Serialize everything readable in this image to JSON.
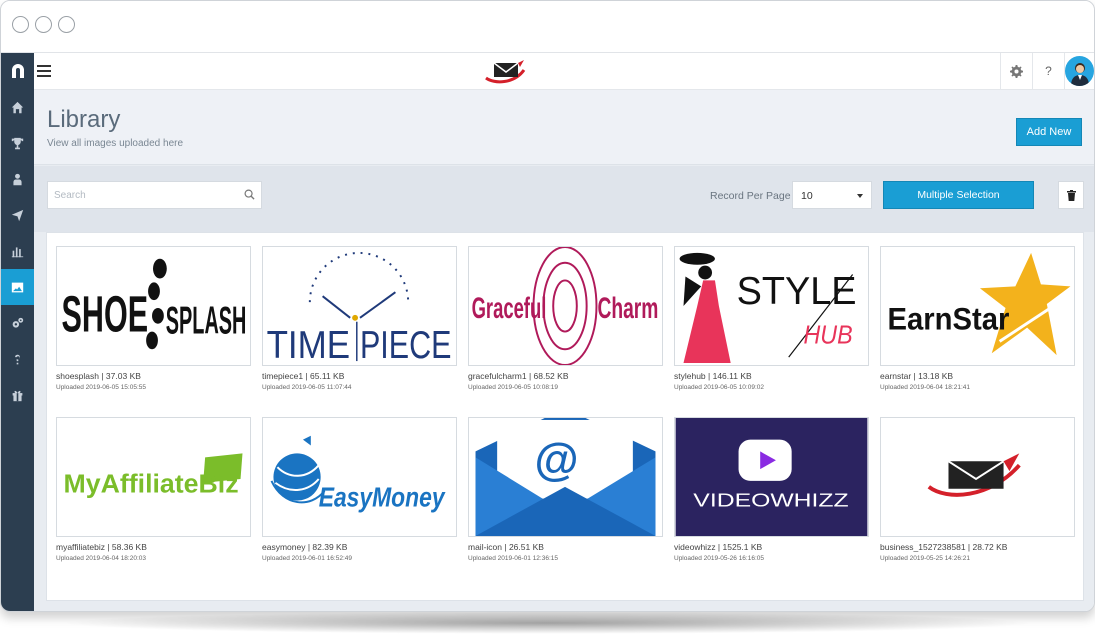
{
  "header": {
    "title": "Library",
    "subtitle": "View all images uploaded here",
    "add_new_label": "Add New"
  },
  "toolbar": {
    "search_placeholder": "Search",
    "record_per_page_label": "Record Per Page",
    "record_per_page_value": "10",
    "multiple_selection_label": "Multiple Selection"
  },
  "topbar": {
    "help_label": "?"
  },
  "sidebar": {
    "items": [
      "home-icon",
      "trophy-icon",
      "user-icon",
      "send-icon",
      "bar-chart-icon",
      "image-icon",
      "cogs-icon",
      "help-icon",
      "gift-icon"
    ],
    "active": "image-icon"
  },
  "colors": {
    "accent": "#1a9ed4",
    "sidebar_bg": "#2c3e50"
  },
  "images": [
    {
      "name": "shoesplash | 37.03 KB",
      "uploaded": "Uploaded 2019-06-05 15:05:55",
      "logo_text": [
        "SHOE",
        "SPLASH"
      ]
    },
    {
      "name": "timepiece1 | 65.11 KB",
      "uploaded": "Uploaded 2019-06-05 11:07:44",
      "logo_text": [
        "TIME",
        "PIECE"
      ]
    },
    {
      "name": "gracefulcharm1 | 68.52 KB",
      "uploaded": "Uploaded 2019-06-05 10:08:19",
      "logo_text": [
        "Graceful",
        "Charm"
      ]
    },
    {
      "name": "stylehub | 146.11 KB",
      "uploaded": "Uploaded 2019-06-05 10:09:02",
      "logo_text": [
        "STYLE",
        "HUB"
      ]
    },
    {
      "name": "earnstar | 13.18 KB",
      "uploaded": "Uploaded 2019-06-04 18:21:41",
      "logo_text": [
        "EarnStar"
      ]
    },
    {
      "name": "myaffiliatebiz | 58.36 KB",
      "uploaded": "Uploaded 2019-06-04 18:20:03",
      "logo_text": [
        "MyAffiliateBiz"
      ]
    },
    {
      "name": "easymoney | 82.39 KB",
      "uploaded": "Uploaded 2019-06-01 16:52:49",
      "logo_text": [
        "EasyMoney"
      ]
    },
    {
      "name": "mail-icon | 26.51 KB",
      "uploaded": "Uploaded 2019-06-01 12:36:15",
      "logo_text": [
        "@"
      ]
    },
    {
      "name": "videowhizz | 1525.1 KB",
      "uploaded": "Uploaded 2019-05-26 16:16:05",
      "logo_text": [
        "VIDEOWHIZZ"
      ]
    },
    {
      "name": "business_1527238581 | 28.72 KB",
      "uploaded": "Uploaded 2019-05-25 14:26:21",
      "logo_text": []
    }
  ]
}
